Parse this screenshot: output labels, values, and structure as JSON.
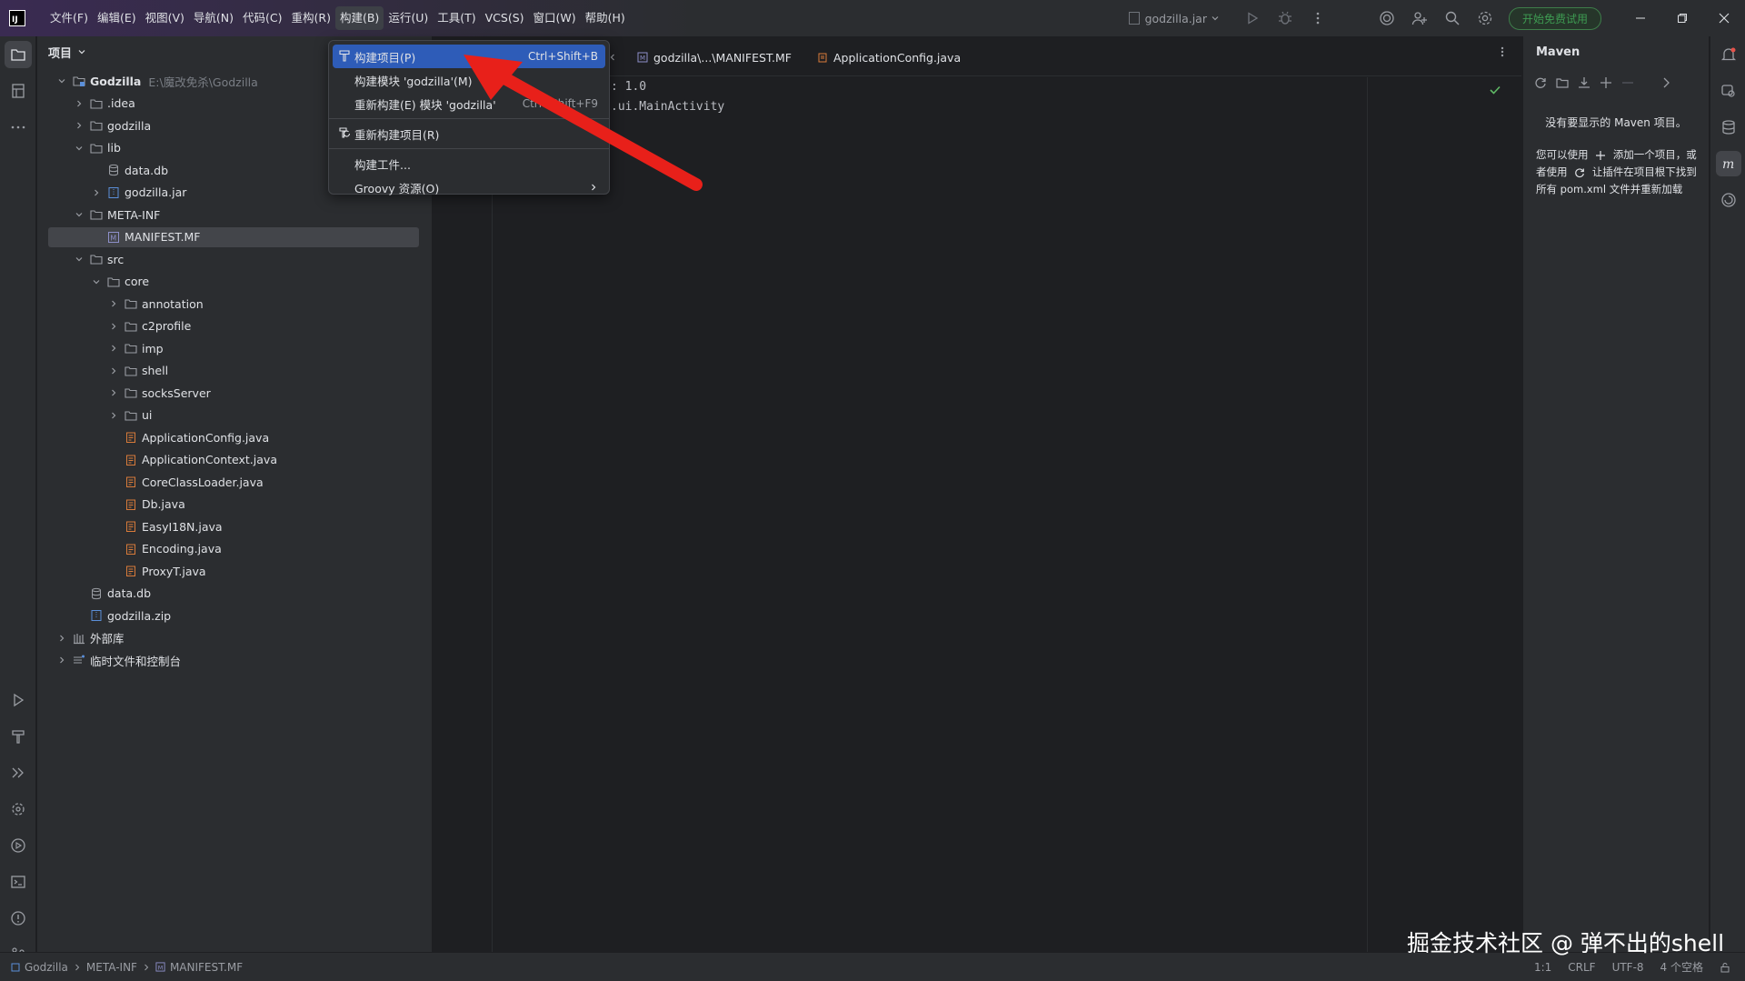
{
  "titlebar": {
    "menus": [
      "文件(F)",
      "编辑(E)",
      "视图(V)",
      "导航(N)",
      "代码(C)",
      "重构(R)",
      "构建(B)",
      "运行(U)",
      "工具(T)",
      "VCS(S)",
      "窗口(W)",
      "帮助(H)"
    ],
    "active_menu_index": 6,
    "run_config": "godzilla.jar",
    "trial_button": "开始免费试用"
  },
  "project_panel": {
    "title": "项目",
    "tree": [
      {
        "label": "Godzilla",
        "hint": "E:\\魔改免杀\\Godzilla",
        "level": 0,
        "arrow": "down",
        "icon": "module-folder",
        "bold": true
      },
      {
        "label": ".idea",
        "level": 1,
        "arrow": "right",
        "icon": "folder"
      },
      {
        "label": "godzilla",
        "level": 1,
        "arrow": "right",
        "icon": "folder"
      },
      {
        "label": "lib",
        "level": 1,
        "arrow": "down",
        "icon": "folder"
      },
      {
        "label": "data.db",
        "level": 2,
        "arrow": "none",
        "icon": "db"
      },
      {
        "label": "godzilla.jar",
        "level": 2,
        "arrow": "right",
        "icon": "archive"
      },
      {
        "label": "META-INF",
        "level": 1,
        "arrow": "down",
        "icon": "folder"
      },
      {
        "label": "MANIFEST.MF",
        "level": 2,
        "arrow": "none",
        "icon": "manifest",
        "selected": true
      },
      {
        "label": "src",
        "level": 1,
        "arrow": "down",
        "icon": "folder"
      },
      {
        "label": "core",
        "level": 2,
        "arrow": "down",
        "icon": "folder"
      },
      {
        "label": "annotation",
        "level": 3,
        "arrow": "right",
        "icon": "folder"
      },
      {
        "label": "c2profile",
        "level": 3,
        "arrow": "right",
        "icon": "folder"
      },
      {
        "label": "imp",
        "level": 3,
        "arrow": "right",
        "icon": "folder"
      },
      {
        "label": "shell",
        "level": 3,
        "arrow": "right",
        "icon": "folder"
      },
      {
        "label": "socksServer",
        "level": 3,
        "arrow": "right",
        "icon": "folder"
      },
      {
        "label": "ui",
        "level": 3,
        "arrow": "right",
        "icon": "folder"
      },
      {
        "label": "ApplicationConfig.java",
        "level": 3,
        "arrow": "none",
        "icon": "java"
      },
      {
        "label": "ApplicationContext.java",
        "level": 3,
        "arrow": "none",
        "icon": "java"
      },
      {
        "label": "CoreClassLoader.java",
        "level": 3,
        "arrow": "none",
        "icon": "java"
      },
      {
        "label": "Db.java",
        "level": 3,
        "arrow": "none",
        "icon": "java"
      },
      {
        "label": "EasyI18N.java",
        "level": 3,
        "arrow": "none",
        "icon": "java"
      },
      {
        "label": "Encoding.java",
        "level": 3,
        "arrow": "none",
        "icon": "java"
      },
      {
        "label": "ProxyT.java",
        "level": 3,
        "arrow": "none",
        "icon": "java"
      },
      {
        "label": "data.db",
        "level": 1,
        "arrow": "none",
        "icon": "db"
      },
      {
        "label": "godzilla.zip",
        "level": 1,
        "arrow": "none",
        "icon": "archive"
      },
      {
        "label": "外部库",
        "level": 0,
        "arrow": "right",
        "icon": "library"
      },
      {
        "label": "临时文件和控制台",
        "level": 0,
        "arrow": "right",
        "icon": "scratch"
      }
    ]
  },
  "editor": {
    "tabs": [
      {
        "label": "godzilla\\...\\MANIFEST.MF",
        "icon": "manifest"
      },
      {
        "label": "ApplicationConfig.java",
        "icon": "java"
      }
    ],
    "code_lines": [
      ": 1.0",
      ".ui.MainActivity"
    ]
  },
  "build_menu": {
    "items": [
      {
        "label": "构建项目(P)",
        "shortcut": "Ctrl+Shift+B",
        "icon": "hammer",
        "highlighted": true
      },
      {
        "label": "构建模块 'godzilla'(M)",
        "shortcut": ""
      },
      {
        "label": "重新构建(E) 模块 'godzilla'",
        "shortcut": "Ctrl+Shift+F9"
      },
      {
        "separator": true
      },
      {
        "label": "重新构建项目(R)",
        "shortcut": "",
        "icon": "rebuild"
      },
      {
        "separator": true
      },
      {
        "label": "构建工件...",
        "shortcut": ""
      },
      {
        "label": "Groovy 资源(O)",
        "shortcut": "",
        "submenu": true
      }
    ]
  },
  "maven": {
    "title": "Maven",
    "empty_text": "没有要显示的 Maven 项目。",
    "help_part1": "您可以使用",
    "help_part2": "添加一个项目，或者使用",
    "help_part3": "让插件在项目根下找到所有 pom.xml 文件并重新加载"
  },
  "statusbar": {
    "breadcrumbs": [
      "Godzilla",
      "META-INF",
      "MANIFEST.MF"
    ],
    "position": "1:1",
    "line_ending": "CRLF",
    "encoding": "UTF-8",
    "indent": "4 个空格"
  },
  "watermark": "掘金技术社区 @ 弹不出的shell",
  "colors": {
    "accent": "#2e5cb8",
    "annotation_arrow": "#e8201a",
    "trial_green": "#3e9b52"
  }
}
